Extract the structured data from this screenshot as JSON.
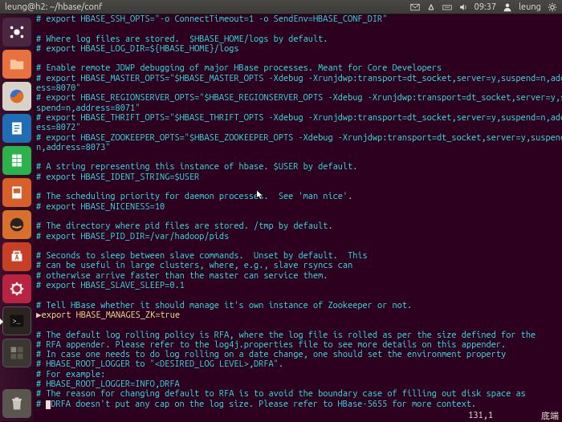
{
  "topbar": {
    "title": "leung@h2: ~/hbase/conf",
    "clock": "09:37",
    "user": "leung"
  },
  "launcher": {
    "items": [
      {
        "id": "dash",
        "bg": "#4b2640"
      },
      {
        "id": "files",
        "bg": "#e8713f"
      },
      {
        "id": "firefox",
        "bg": "#d9d2c8"
      },
      {
        "id": "writer",
        "bg": "#1f6db4"
      },
      {
        "id": "calc",
        "bg": "#2bb24a"
      },
      {
        "id": "impress",
        "bg": "#d85e2a"
      },
      {
        "id": "amazon",
        "bg": "#d86f2c"
      },
      {
        "id": "software",
        "bg": "#c74026"
      },
      {
        "id": "settings",
        "bg": "#b72340"
      },
      {
        "id": "terminal",
        "bg": "#2b2421",
        "selected": true
      },
      {
        "id": "workspaces",
        "bg": "#3a3631"
      },
      {
        "id": "trash",
        "bg": "#5a554e"
      }
    ]
  },
  "editor": {
    "lines": [
      {
        "c": "# export HBASE_SSH_OPTS=\"-o ConnectTimeout=1 -o SendEnv=HBASE_CONF_DIR\""
      },
      {
        "c": ""
      },
      {
        "c": "# Where log files are stored.  $HBASE_HOME/logs by default."
      },
      {
        "c": "# export HBASE_LOG_DIR=${HBASE_HOME}/logs"
      },
      {
        "c": ""
      },
      {
        "c": "# Enable remote JDWP debugging of major HBase processes. Meant for Core Developers"
      },
      {
        "c": "# export HBASE_MASTER_OPTS=\"$HBASE_MASTER_OPTS -Xdebug -Xrunjdwp:transport=dt_socket,server=y,suspend=n,address=8070\""
      },
      {
        "c": "# export HBASE_REGIONSERVER_OPTS=\"$HBASE_REGIONSERVER_OPTS -Xdebug -Xrunjdwp:transport=dt_socket,server=y,suspend=n,address=8071\""
      },
      {
        "c": "# export HBASE_THRIFT_OPTS=\"$HBASE_THRIFT_OPTS -Xdebug -Xrunjdwp:transport=dt_socket,server=y,suspend=n,address=8072\""
      },
      {
        "c": "# export HBASE_ZOOKEEPER_OPTS=\"$HBASE_ZOOKEEPER_OPTS -Xdebug -Xrunjdwp:transport=dt_socket,server=y,suspend=n,address=8073\""
      },
      {
        "c": ""
      },
      {
        "c": "# A string representing this instance of hbase. $USER by default."
      },
      {
        "c": "# export HBASE_IDENT_STRING=$USER"
      },
      {
        "c": ""
      },
      {
        "c": "# The scheduling priority for daemon processes.  See 'man nice'."
      },
      {
        "c": "# export HBASE_NICENESS=10"
      },
      {
        "c": ""
      },
      {
        "c": "# The directory where pid files are stored. /tmp by default."
      },
      {
        "c": "# export HBASE_PID_DIR=/var/hadoop/pids"
      },
      {
        "c": ""
      },
      {
        "c": "# Seconds to sleep between slave commands.  Unset by default.  This"
      },
      {
        "c": "# can be useful in large clusters, where, e.g., slave rsyncs can"
      },
      {
        "c": "# otherwise arrive faster than the master can service them."
      },
      {
        "c": "# export HBASE_SLAVE_SLEEP=0.1"
      },
      {
        "c": ""
      },
      {
        "c": "# Tell HBase whether it should manage it's own instance of Zookeeper or not."
      },
      {
        "c": " export HBASE_MANAGES_ZK=true",
        "type": "code"
      },
      {
        "c": ""
      },
      {
        "c": "# The default log rolling policy is RFA, where the log file is rolled as per the size defined for the"
      },
      {
        "c": "# RFA appender. Please refer to the log4j.properties file to see more details on this appender."
      },
      {
        "c": "# In case one needs to do log rolling on a date change, one should set the environment property"
      },
      {
        "c": "# HBASE_ROOT_LOGGER to \"<DESIRED_LOG LEVEL>,DRFA\"."
      },
      {
        "c": "# For example:"
      },
      {
        "c": "# HBASE_ROOT_LOGGER=INFO,DRFA"
      },
      {
        "c": "# The reason for changing default to RFA is to avoid the boundary case of filling out disk space as"
      },
      {
        "c": "# DRFA doesn't put any cap on the log size. Please refer to HBase-5655 for more context.",
        "cursor": true
      }
    ]
  },
  "status": {
    "pos": "131,1",
    "scroll": "底端"
  },
  "code_kw": {
    "export": "export",
    "rest": " HBASE_MANAGES_ZK=true"
  }
}
